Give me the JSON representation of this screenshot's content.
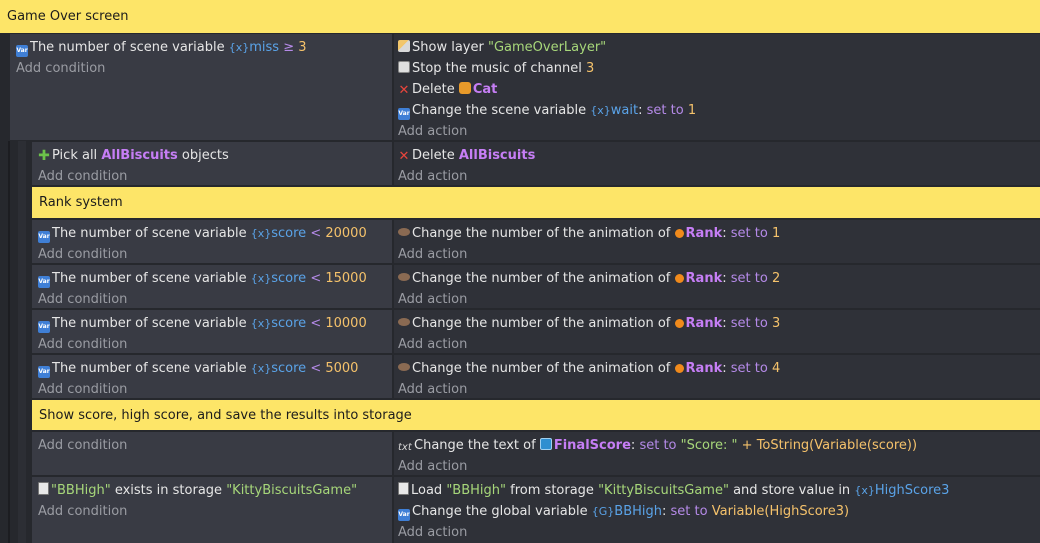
{
  "group_title": "Game Over screen",
  "ev1": {
    "cond_prefix": "The number of scene variable",
    "cond_var": "miss",
    "cond_op": "≥",
    "cond_val": "3",
    "add_condition": "Add condition",
    "a1_text": "Show layer",
    "a1_arg": "\"GameOverLayer\"",
    "a2_text": "Stop the music of channel",
    "a2_arg": "3",
    "a3_text": "Delete",
    "a3_obj": "Cat",
    "a4_text": "Change the scene variable",
    "a4_var": "wait",
    "a4_sep": ":",
    "a4_op": "set to",
    "a4_val": "1",
    "add_action": "Add action"
  },
  "ev2": {
    "cond_prefix": "Pick all",
    "cond_obj": "AllBiscuits",
    "cond_suffix": "objects",
    "add_condition": "Add condition",
    "a1_text": "Delete",
    "a1_obj": "AllBiscuits",
    "add_action": "Add action"
  },
  "comment_rank": "Rank system",
  "rank_events": [
    {
      "cond_prefix": "The number of scene variable",
      "var": "score",
      "op": "<",
      "val": "20000",
      "act_text": "Change the number of the animation of",
      "obj": "Rank",
      "sep": ":",
      "set": "set to",
      "set_val": "1"
    },
    {
      "cond_prefix": "The number of scene variable",
      "var": "score",
      "op": "<",
      "val": "15000",
      "act_text": "Change the number of the animation of",
      "obj": "Rank",
      "sep": ":",
      "set": "set to",
      "set_val": "2"
    },
    {
      "cond_prefix": "The number of scene variable",
      "var": "score",
      "op": "<",
      "val": "10000",
      "act_text": "Change the number of the animation of",
      "obj": "Rank",
      "sep": ":",
      "set": "set to",
      "set_val": "3"
    },
    {
      "cond_prefix": "The number of scene variable",
      "var": "score",
      "op": "<",
      "val": "5000",
      "act_text": "Change the number of the animation of",
      "obj": "Rank",
      "sep": ":",
      "set": "set to",
      "set_val": "4"
    }
  ],
  "add_condition": "Add condition",
  "add_action": "Add action",
  "comment_score": "Show score, high score, and save the results into storage",
  "ev_text": {
    "add_condition": "Add condition",
    "a_text": "Change the text of",
    "a_obj": "FinalScore",
    "a_sep": ":",
    "a_op": "set to",
    "a_val_str": "\"Score: \"",
    "a_val_expr": "+ ToString(Variable(score))",
    "add_action": "Add action"
  },
  "ev_storage": {
    "cond_key": "\"BBHigh\"",
    "cond_mid": "exists in storage",
    "cond_store": "\"KittyBiscuitsGame\"",
    "add_condition": "Add condition",
    "a1_text": "Load",
    "a1_key": "\"BBHigh\"",
    "a1_mid": "from storage",
    "a1_store": "\"KittyBiscuitsGame\"",
    "a1_mid2": "and store value in",
    "a1_var": "HighScore3",
    "a2_text": "Change the global variable",
    "a2_var": "BBHigh",
    "a2_sep": ":",
    "a2_op": "set to",
    "a2_val": "Variable(HighScore3)",
    "add_action": "Add action"
  },
  "icons": {
    "variable": "variable-icon",
    "layer": "pencil-icon",
    "music": "music-icon",
    "delete": "delete-x-icon",
    "pick": "pick-all-icon",
    "animation": "animation-icon",
    "text": "text-icon",
    "storage": "storage-icon"
  },
  "colors": {
    "comment_bg": "#fde568",
    "condition_bg": "#393b44",
    "action_bg": "#2f3138",
    "object_name": "#c67ef5",
    "variable_name": "#5aa3e8",
    "string_value": "#a7d77a",
    "number_value": "#f5c26b",
    "operator": "#b58ae8"
  }
}
